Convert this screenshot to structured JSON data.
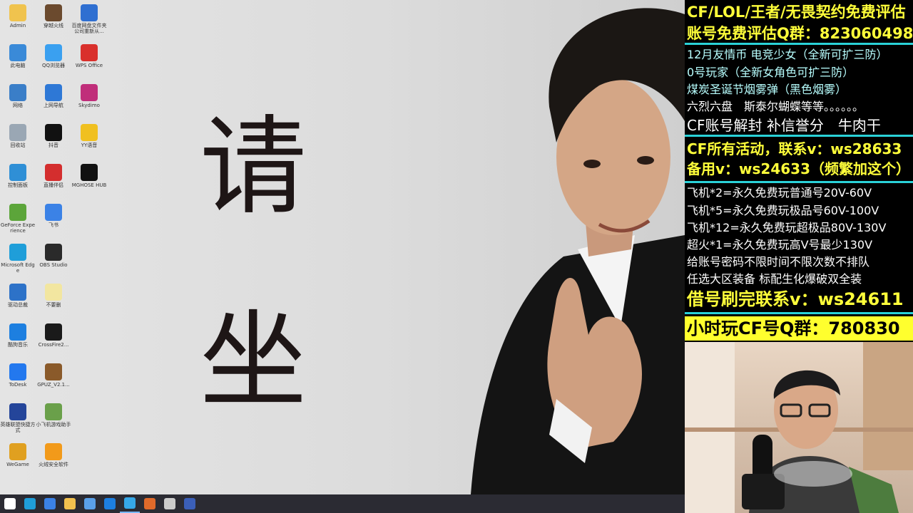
{
  "desktop": {
    "icons": [
      {
        "label": "Admin",
        "color": "#f0c34e"
      },
      {
        "label": "穿越火线",
        "color": "#6b4a2e"
      },
      {
        "label": "百度网盘文件夹公司重新从...",
        "color": "#2f6fd1"
      },
      {
        "label": "此电脑",
        "color": "#3a8ad8"
      },
      {
        "label": "QQ浏览器",
        "color": "#3aa0f0"
      },
      {
        "label": "WPS Office",
        "color": "#d9302c"
      },
      {
        "label": "网络",
        "color": "#3a7ec8"
      },
      {
        "label": "上网导航",
        "color": "#2e78d6"
      },
      {
        "label": "Skydimo",
        "color": "#c02e7a"
      },
      {
        "label": "回收站",
        "color": "#9aa7b4"
      },
      {
        "label": "抖音",
        "color": "#111111"
      },
      {
        "label": "YY语音",
        "color": "#f0c020"
      },
      {
        "label": "控制面板",
        "color": "#2f8fd6"
      },
      {
        "label": "直播伴侣",
        "color": "#d42e2e"
      },
      {
        "label": "MGHOSE HUB",
        "color": "#111111"
      },
      {
        "label": "GeForce Experience",
        "color": "#5ca53a"
      },
      {
        "label": "飞书",
        "color": "#3b82e6"
      },
      {
        "label": "Microsoft Edge",
        "color": "#1f9ed9"
      },
      {
        "label": "OBS Studio",
        "color": "#2a2a2a"
      },
      {
        "label": "驱动总裁",
        "color": "#2d72c8"
      },
      {
        "label": "不要删",
        "color": "#f2e6a0"
      },
      {
        "label": "酷狗音乐",
        "color": "#1d7fe0"
      },
      {
        "label": "CrossFire2...",
        "color": "#1a1a1a"
      },
      {
        "label": "ToDesk",
        "color": "#2378ee"
      },
      {
        "label": "GPUZ_V2.1...",
        "color": "#8a5a2a"
      },
      {
        "label": "英雄联盟快捷方式",
        "color": "#24459a"
      },
      {
        "label": "小飞机游戏助手",
        "color": "#6aa04a"
      },
      {
        "label": "WeGame",
        "color": "#e0a020"
      },
      {
        "label": "火绒安全软件",
        "color": "#f29a1a"
      }
    ],
    "wallpaper_chars": [
      "请",
      "坐"
    ]
  },
  "taskbar": {
    "items": [
      {
        "icon": "windows-start-icon",
        "color": "#ffffff"
      },
      {
        "icon": "edge-icon",
        "color": "#1f9ed9"
      },
      {
        "icon": "feishu-icon",
        "color": "#3b82e6"
      },
      {
        "icon": "file-explorer-icon",
        "color": "#f2c14e"
      },
      {
        "icon": "store-icon",
        "color": "#5aa0e8"
      },
      {
        "icon": "kugou-icon",
        "color": "#1d7fe0"
      },
      {
        "icon": "edge-active-icon",
        "color": "#36a8e8"
      },
      {
        "icon": "app-g-icon",
        "color": "#e06a2a"
      },
      {
        "icon": "obs-icon",
        "color": "#cccccc"
      },
      {
        "icon": "app-n-icon",
        "color": "#3b5fb8"
      }
    ]
  },
  "panel": {
    "lines": [
      {
        "text": "CF/LOL/王者/无畏契约免费评估",
        "style": "y",
        "size": 21
      },
      {
        "text": "账号免费评估Q群：823060498",
        "style": "y",
        "size": 21
      },
      {
        "text": "12月友情币 电竞少女（全新可扩三防）",
        "style": "c",
        "size": 16
      },
      {
        "text": "0号玩家（全新女角色可扩三防）",
        "style": "c",
        "size": 16
      },
      {
        "text": "煤炭圣诞节烟雾弹（黑色烟雾）",
        "style": "c",
        "size": 16
      },
      {
        "text": "六烈六盘　斯泰尔蝴蝶等等。。。。。。",
        "style": "w",
        "size": 16
      },
      {
        "text": "CF账号解封 补信誉分　牛肉干",
        "style": "w",
        "size": 20
      },
      {
        "text": "CF所有活动，联系v：ws28633",
        "style": "y",
        "size": 20
      },
      {
        "text": "备用v：ws24633（频繁加这个）",
        "style": "y",
        "size": 20
      },
      {
        "text": "飞机*2=永久免费玩普通号20V-60V",
        "style": "w",
        "size": 16
      },
      {
        "text": "飞机*5=永久免费玩极品号60V-100V",
        "style": "w",
        "size": 16
      },
      {
        "text": "飞机*12=永久免费玩超极品80V-130V",
        "style": "w",
        "size": 16
      },
      {
        "text": "超火*1=永久免费玩高V号最少130V",
        "style": "w",
        "size": 16
      },
      {
        "text": "给账号密码不限时间不限次数不排队",
        "style": "w",
        "size": 16
      },
      {
        "text": "任选大区装备 标配生化爆破双全装",
        "style": "w",
        "size": 16
      },
      {
        "text": "借号刷完联系v：ws24611",
        "style": "y",
        "size": 24
      },
      {
        "text": "小时玩CF号Q群：780830",
        "style": "blackonyellow",
        "size": 24
      }
    ]
  }
}
